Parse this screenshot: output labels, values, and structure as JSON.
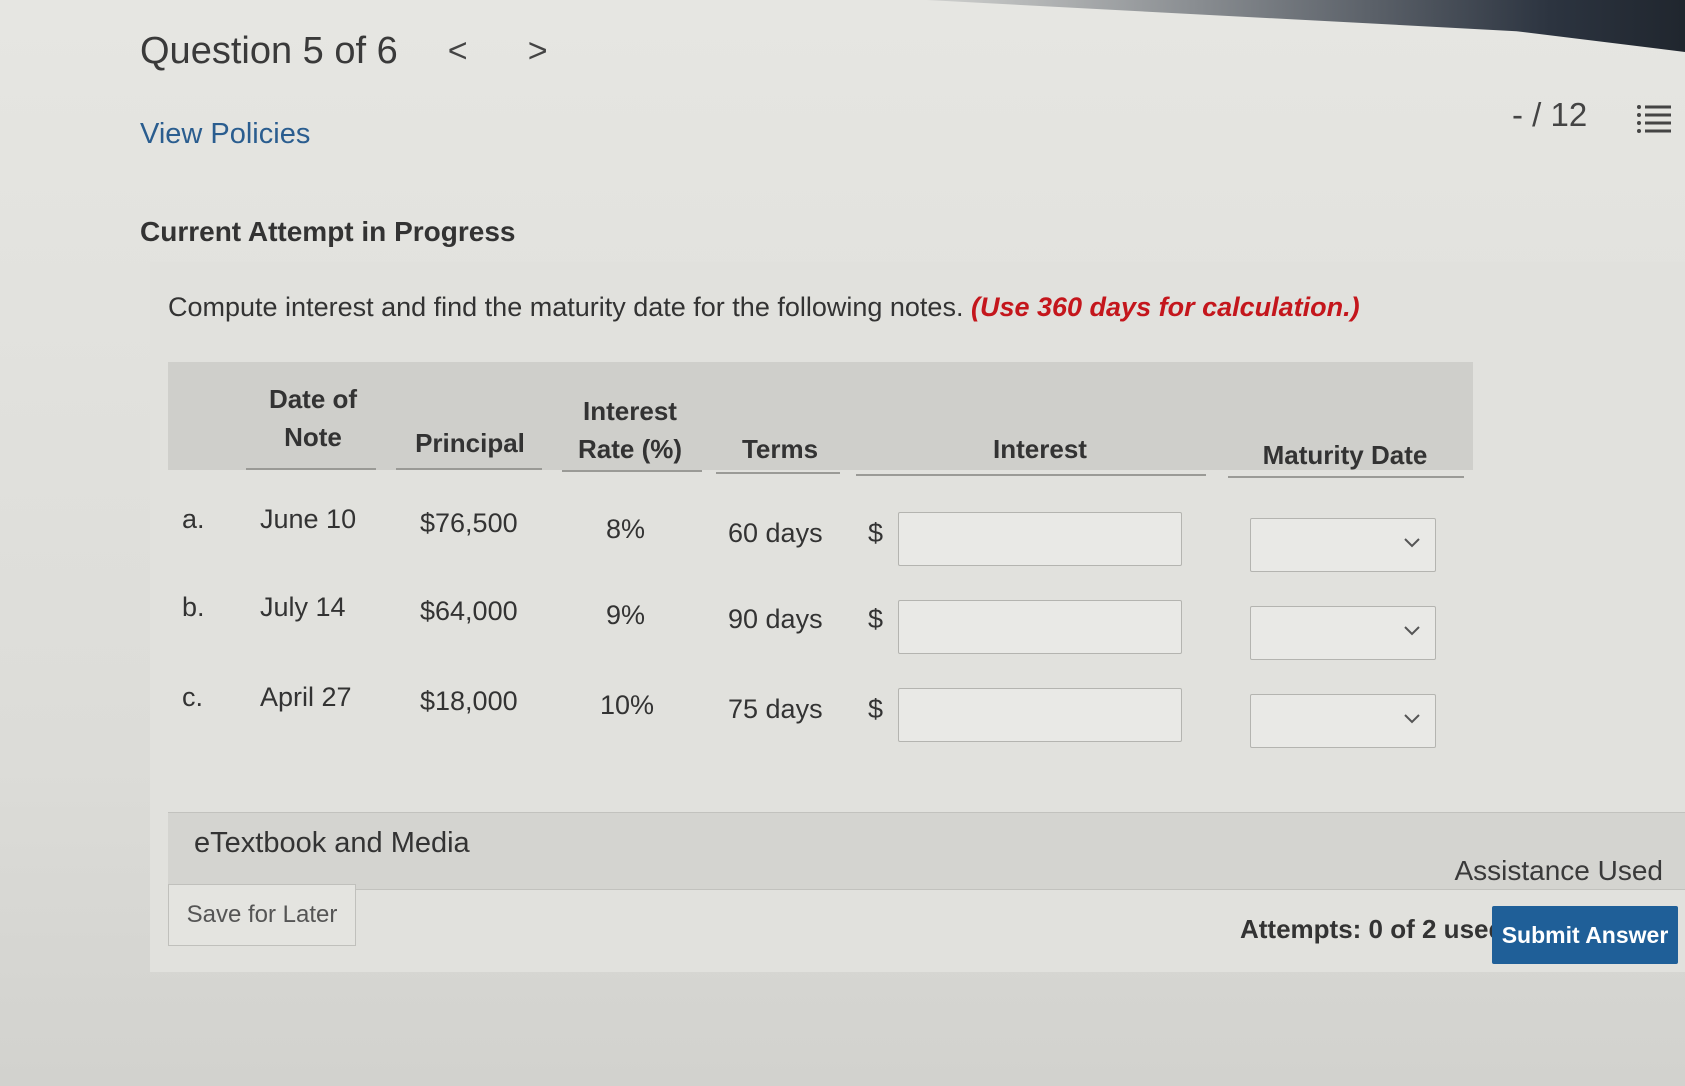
{
  "header": {
    "question_label": "Question 5 of 6",
    "prev_glyph": "<",
    "next_glyph": ">",
    "view_policies": "View Policies",
    "score": "- / 12"
  },
  "attempt_title": "Current Attempt in Progress",
  "instructions": {
    "text": "Compute interest and find the maturity date for the following notes.",
    "note": "(Use 360 days for calculation.)"
  },
  "table": {
    "headers": {
      "date_line1": "Date of",
      "date_line2": "Note",
      "principal": "Principal",
      "rate_line1": "Interest",
      "rate_line2": "Rate (%)",
      "terms": "Terms",
      "interest": "Interest",
      "maturity": "Maturity Date"
    },
    "rows": [
      {
        "label": "a.",
        "date": "June 10",
        "principal": "$76,500",
        "rate": "8%",
        "terms": "60 days",
        "currency": "$",
        "interest_value": "",
        "maturity_value": ""
      },
      {
        "label": "b.",
        "date": "July 14",
        "principal": "$64,000",
        "rate": "9%",
        "terms": "90 days",
        "currency": "$",
        "interest_value": "",
        "maturity_value": ""
      },
      {
        "label": "c.",
        "date": "April 27",
        "principal": "$18,000",
        "rate": "10%",
        "terms": "75 days",
        "currency": "$",
        "interest_value": "",
        "maturity_value": ""
      }
    ]
  },
  "etextbook": "eTextbook and Media",
  "assistance": "Assistance Used",
  "save_button": "Save for Later",
  "attempts": "Attempts: 0 of 2 used",
  "submit_button": "Submit Answer",
  "colors": {
    "link": "#2a5d8f",
    "emphasis_red": "#c4161c",
    "submit_blue": "#1f5f98"
  }
}
